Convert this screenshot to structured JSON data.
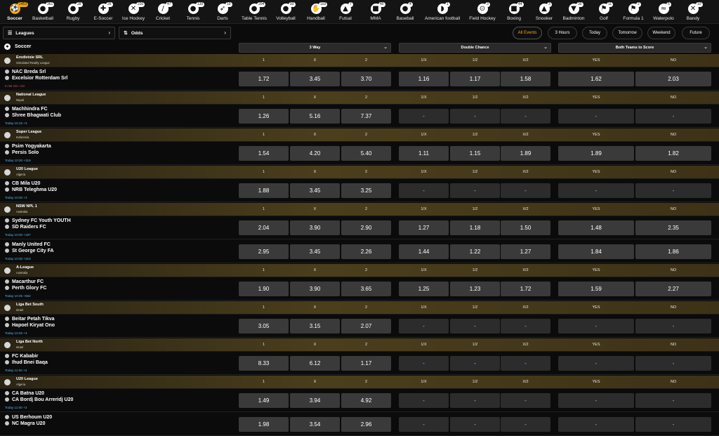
{
  "sports": [
    {
      "name": "Soccer",
      "count": "1453",
      "icon": "soccer-ball-icon",
      "glyph": "⚽",
      "active": true
    },
    {
      "name": "Basketball",
      "count": "361",
      "icon": "basketball-icon",
      "glyph": "●"
    },
    {
      "name": "Rugby",
      "count": "28",
      "icon": "rugby-ball-icon",
      "glyph": "●"
    },
    {
      "name": "E-Soccer",
      "count": "26",
      "icon": "gamepad-icon",
      "glyph": "✚"
    },
    {
      "name": "Ice Hockey",
      "count": "220",
      "icon": "hockey-sticks-icon",
      "glyph": "✕"
    },
    {
      "name": "Cricket",
      "count": "47",
      "icon": "cricket-bat-icon",
      "glyph": "/"
    },
    {
      "name": "Tennis",
      "count": "130",
      "icon": "tennis-racket-icon",
      "glyph": "●"
    },
    {
      "name": "Darts",
      "count": "19",
      "icon": "dart-icon",
      "glyph": "➶"
    },
    {
      "name": "Table Tennis",
      "count": "204",
      "icon": "table-tennis-icon",
      "glyph": "●"
    },
    {
      "name": "Volleyball",
      "count": "93",
      "icon": "volleyball-icon",
      "glyph": "●"
    },
    {
      "name": "Handball",
      "count": "103",
      "icon": "handball-icon",
      "glyph": "✋"
    },
    {
      "name": "Futsal",
      "count": "7",
      "icon": "futsal-shoe-icon",
      "glyph": "▲"
    },
    {
      "name": "MMA",
      "count": "40",
      "icon": "boxing-glove-icon",
      "glyph": "■"
    },
    {
      "name": "Baseball",
      "count": "4",
      "icon": "baseball-icon",
      "glyph": "●"
    },
    {
      "name": "American football",
      "count": "1",
      "icon": "football-helmet-icon",
      "glyph": "◗"
    },
    {
      "name": "Field Hockey",
      "count": "3",
      "icon": "field-hockey-icon",
      "glyph": "⊙"
    },
    {
      "name": "Boxing",
      "count": "44",
      "icon": "boxing-icon",
      "glyph": "■"
    },
    {
      "name": "Snooker",
      "count": "3",
      "icon": "snooker-triangle-icon",
      "glyph": "▲"
    },
    {
      "name": "Badminton",
      "count": "30",
      "icon": "shuttlecock-icon",
      "glyph": "▼"
    },
    {
      "name": "Golf",
      "count": "11",
      "icon": "golf-flag-icon",
      "glyph": "⚑"
    },
    {
      "name": "Formula 1",
      "count": "2",
      "icon": "checkered-flag-icon",
      "glyph": "⚑"
    },
    {
      "name": "Waterpolo",
      "count": "5",
      "icon": "waterpolo-icon",
      "glyph": "≈"
    },
    {
      "name": "Bandy",
      "count": "10",
      "icon": "bandy-icon",
      "glyph": "✕"
    }
  ],
  "filters": {
    "leagues_label": "Leagues",
    "odds_label": "Odds",
    "leagues_icon": "list-icon",
    "odds_icon": "sort-arrows-icon"
  },
  "time_filters": [
    "All Events",
    "3 Hours",
    "Today",
    "Tomorrow",
    "Weekend",
    "Future"
  ],
  "header": {
    "sport_title": "Soccer",
    "sport_icon": "soccer-ball-icon",
    "markets": [
      "3 Way",
      "Double Chance",
      "Both Teams to Score"
    ]
  },
  "columns": [
    "1",
    "X",
    "2",
    "1/X",
    "1/2",
    "X/2",
    "YES",
    "NO"
  ],
  "rows": [
    {
      "type": "league",
      "name": "Eredivisie SRL",
      "sub": "Simulated Reality League",
      "flag": "globe-icon"
    },
    {
      "type": "match",
      "home": "NAC Breda Srl",
      "away": "Excelsior Rotterdam Srl",
      "time": "In 50 min +44",
      "live": true,
      "odds": [
        "1.72",
        "3.45",
        "3.70",
        "1.16",
        "1.17",
        "1.58",
        "1.62",
        "2.03"
      ]
    },
    {
      "type": "league",
      "name": "National League",
      "sub": "Nepal",
      "flag": "nepal-flag-icon"
    },
    {
      "type": "match",
      "home": "Machhindra FC",
      "away": "Shree Bhagwati Club",
      "time": "Today 10:15 +3",
      "odds": [
        "1.26",
        "5.16",
        "7.37",
        "-",
        "-",
        "-",
        "-",
        "-"
      ]
    },
    {
      "type": "league",
      "name": "Super League",
      "sub": "Indonesia",
      "flag": "indonesia-flag-icon"
    },
    {
      "type": "match",
      "home": "Psim Yogyakarta",
      "away": "Persis Solo",
      "time": "Today 10:30 +319",
      "odds": [
        "1.54",
        "4.20",
        "5.40",
        "1.11",
        "1.15",
        "1.89",
        "1.89",
        "1.82"
      ]
    },
    {
      "type": "league",
      "name": "U20 League",
      "sub": "Algeria",
      "flag": "algeria-flag-icon"
    },
    {
      "type": "match",
      "home": "CB Mila U20",
      "away": "NRB Teleghma U20",
      "time": "Today 10:30 +3",
      "odds": [
        "1.88",
        "3.45",
        "3.25",
        "-",
        "-",
        "-",
        "-",
        "-"
      ]
    },
    {
      "type": "league",
      "name": "NSW NPL 1",
      "sub": "Australia",
      "flag": "australia-flag-icon"
    },
    {
      "type": "match",
      "home": "Sydney FC Youth YOUTH",
      "away": "SD Raiders FC",
      "time": "Today 10:30 +197",
      "odds": [
        "2.04",
        "3.90",
        "2.90",
        "1.27",
        "1.18",
        "1.50",
        "1.48",
        "2.35"
      ]
    },
    {
      "type": "match",
      "home": "Manly United FC",
      "away": "St George City FA",
      "time": "Today 10:30 +310",
      "odds": [
        "2.95",
        "3.45",
        "2.26",
        "1.44",
        "1.22",
        "1.27",
        "1.84",
        "1.86"
      ]
    },
    {
      "type": "league",
      "name": "A-League",
      "sub": "Australia",
      "flag": "australia-flag-icon"
    },
    {
      "type": "match",
      "home": "Macarthur FC",
      "away": "Perth Glory FC",
      "time": "Today 10:35 +662",
      "odds": [
        "1.90",
        "3.90",
        "3.65",
        "1.25",
        "1.23",
        "1.72",
        "1.59",
        "2.27"
      ]
    },
    {
      "type": "league",
      "name": "Liga Bet South",
      "sub": "Israel",
      "flag": "israel-flag-icon"
    },
    {
      "type": "match",
      "home": "Beitar Petah Tikva",
      "away": "Hapoel Kiryat Ono",
      "time": "Today 10:45 +3",
      "odds": [
        "3.05",
        "3.15",
        "2.07",
        "-",
        "-",
        "-",
        "-",
        "-"
      ]
    },
    {
      "type": "league",
      "name": "Liga Bet North",
      "sub": "Israel",
      "flag": "israel-flag-icon"
    },
    {
      "type": "match",
      "home": "FC Kababir",
      "away": "Ihud Bnei Baqa",
      "time": "Today 11:00 +3",
      "odds": [
        "8.33",
        "6.12",
        "1.17",
        "-",
        "-",
        "-",
        "-",
        "-"
      ]
    },
    {
      "type": "league",
      "name": "U20 League",
      "sub": "Algeria",
      "flag": "algeria-flag-icon"
    },
    {
      "type": "match",
      "home": "CA Batna U20",
      "away": "CA Bordj Bou Arreridj U20",
      "time": "Today 11:00 +3",
      "odds": [
        "1.49",
        "3.94",
        "4.92",
        "-",
        "-",
        "-",
        "-",
        "-"
      ]
    },
    {
      "type": "match",
      "home": "US Berhoum U20",
      "away": "NC Magra U20",
      "time": "",
      "odds": [
        "1.98",
        "3.54",
        "2.96",
        "-",
        "-",
        "-",
        "-",
        "-"
      ]
    }
  ],
  "colors": {
    "accent": "#f0a80c",
    "odds_bg": "#3a3a3a",
    "league_band": "#4a3e1c",
    "time_text": "#59b5e8",
    "live_text": "#e05252"
  }
}
